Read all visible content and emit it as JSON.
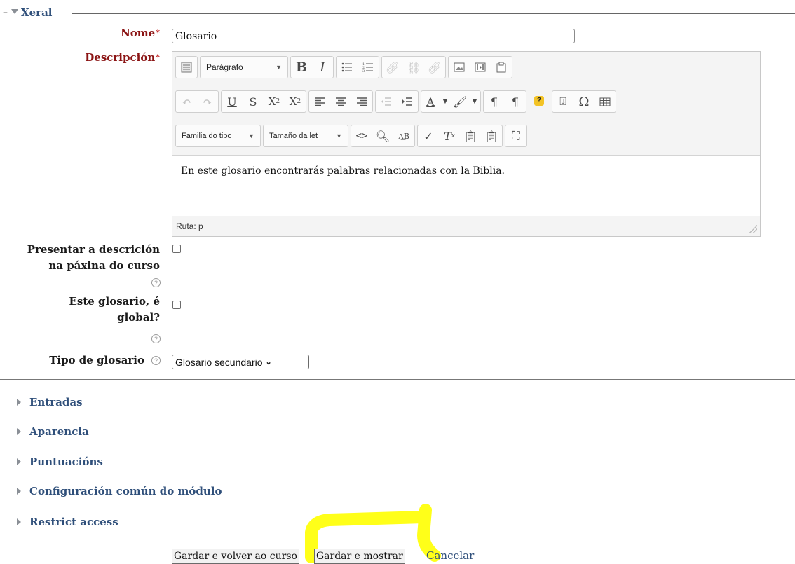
{
  "general": {
    "title": "Xeral"
  },
  "name": {
    "label": "Nome",
    "required_mark": "*",
    "value": "Glosario"
  },
  "description": {
    "label": "Descripción",
    "required_mark": "*",
    "toolbar": {
      "paragraph_format": "Parágrafo",
      "font_family": "Familia do tipc",
      "font_size": "Tamaño da let"
    },
    "content": "En este glosario encontrarás palabras relacionadas con la Biblia.",
    "path_label": "Ruta: p"
  },
  "show_description": {
    "label_line1": "Presentar a descrición",
    "label_line2": "na páxina do curso",
    "checked": false
  },
  "global_glossary": {
    "label_line1": "Este glosario, é",
    "label_line2": "global?",
    "checked": false
  },
  "glossary_type": {
    "label": "Tipo de glosario",
    "selected": "Glosario secundario"
  },
  "sections": [
    {
      "label": "Entradas"
    },
    {
      "label": "Aparencia"
    },
    {
      "label": "Puntuacións"
    },
    {
      "label": "Configuración común do módulo"
    },
    {
      "label": "Restrict access"
    }
  ],
  "actions": {
    "save_return": "Gardar e volver ao curso",
    "save_display": "Gardar e mostrar",
    "cancel": "Cancelar"
  },
  "highlight_color": "#ffff00"
}
